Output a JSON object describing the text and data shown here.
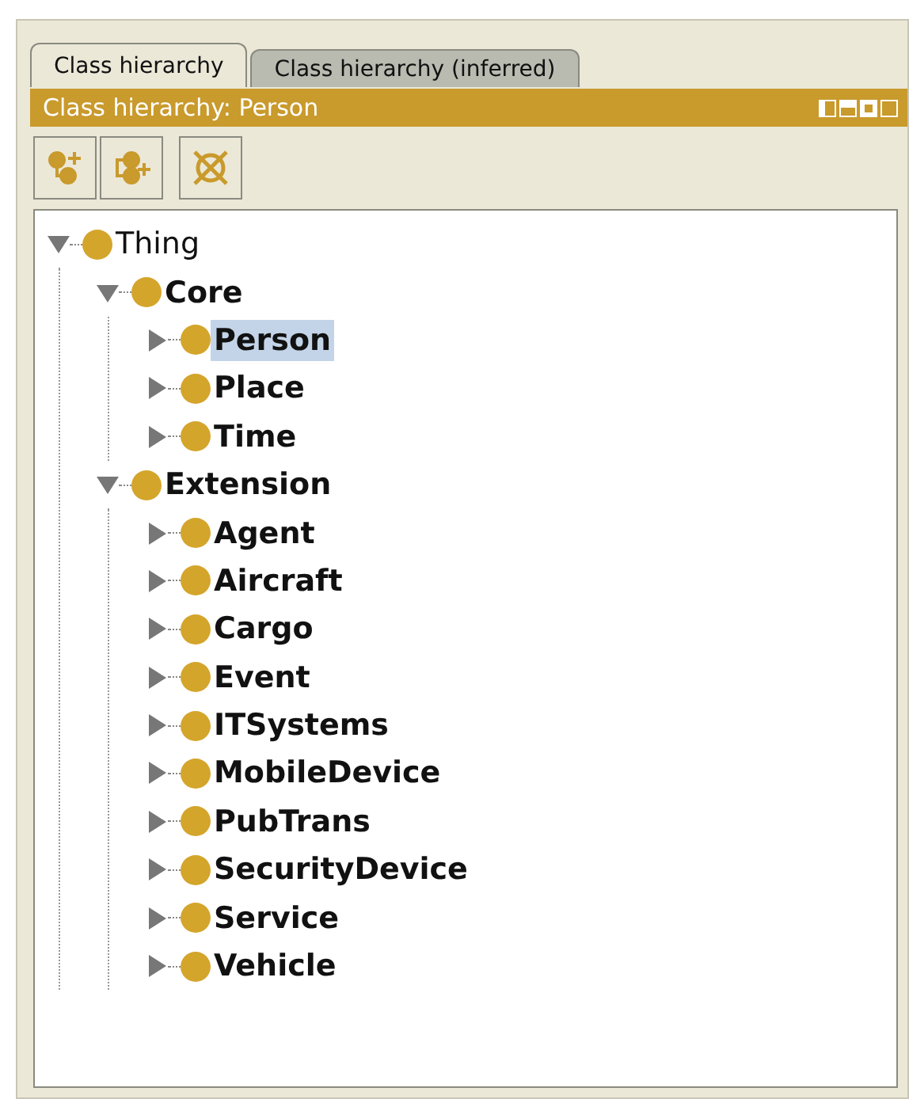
{
  "tabs": [
    {
      "label": "Class hierarchy",
      "selected": true
    },
    {
      "label": "Class hierarchy (inferred)",
      "selected": false
    }
  ],
  "view_header": {
    "title": "Class hierarchy: Person"
  },
  "tree": [
    {
      "label": "Thing",
      "bold": false,
      "expanded": true,
      "selected": false,
      "children": [
        {
          "label": "Core",
          "bold": true,
          "expanded": true,
          "selected": false,
          "children": [
            {
              "label": "Person",
              "bold": true,
              "expanded": false,
              "selected": true
            },
            {
              "label": "Place",
              "bold": true,
              "expanded": false,
              "selected": false
            },
            {
              "label": "Time",
              "bold": true,
              "expanded": false,
              "selected": false
            }
          ]
        },
        {
          "label": "Extension",
          "bold": true,
          "expanded": true,
          "selected": false,
          "children": [
            {
              "label": "Agent",
              "bold": true,
              "expanded": false,
              "selected": false
            },
            {
              "label": "Aircraft",
              "bold": true,
              "expanded": false,
              "selected": false
            },
            {
              "label": "Cargo",
              "bold": true,
              "expanded": false,
              "selected": false
            },
            {
              "label": "Event",
              "bold": true,
              "expanded": false,
              "selected": false
            },
            {
              "label": "ITSystems",
              "bold": true,
              "expanded": false,
              "selected": false
            },
            {
              "label": "MobileDevice",
              "bold": true,
              "expanded": false,
              "selected": false
            },
            {
              "label": "PubTrans",
              "bold": true,
              "expanded": false,
              "selected": false
            },
            {
              "label": "SecurityDevice",
              "bold": true,
              "expanded": false,
              "selected": false
            },
            {
              "label": "Service",
              "bold": true,
              "expanded": false,
              "selected": false
            },
            {
              "label": "Vehicle",
              "bold": true,
              "expanded": false,
              "selected": false
            }
          ]
        }
      ]
    }
  ]
}
